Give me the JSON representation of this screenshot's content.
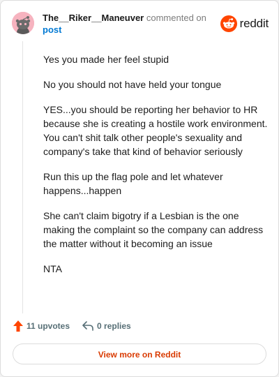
{
  "comment": {
    "username": "The__Riker__Maneuver",
    "action_text": "commented on",
    "post_link": "post",
    "paragraphs": [
      "Yes you made her feel stupid",
      "No you should not have held your tongue",
      "YES...you should be reporting her behavior to HR because she is creating a hostile work environment. You can't shit talk other people's sexuality and company's take that kind of behavior seriously",
      "Run this up the flag pole and let whatever happens...happen",
      "She can't claim bigotry if a Lesbian is the one making the complaint so the company can address the matter without it becoming an issue",
      "NTA"
    ]
  },
  "brand": {
    "name": "reddit",
    "icon": "reddit-logo-icon",
    "color": "#ff4500"
  },
  "footer": {
    "upvotes": "11 upvotes",
    "replies": "0 replies",
    "upvote_icon": "upvote-arrow-icon",
    "reply_icon": "reply-arrow-icon"
  },
  "cta": {
    "label": "View more on Reddit",
    "color": "#d93a00"
  },
  "colors": {
    "avatar_bg": "#f6b3bf",
    "link": "#0079d3",
    "upvote": "#ff4500"
  }
}
